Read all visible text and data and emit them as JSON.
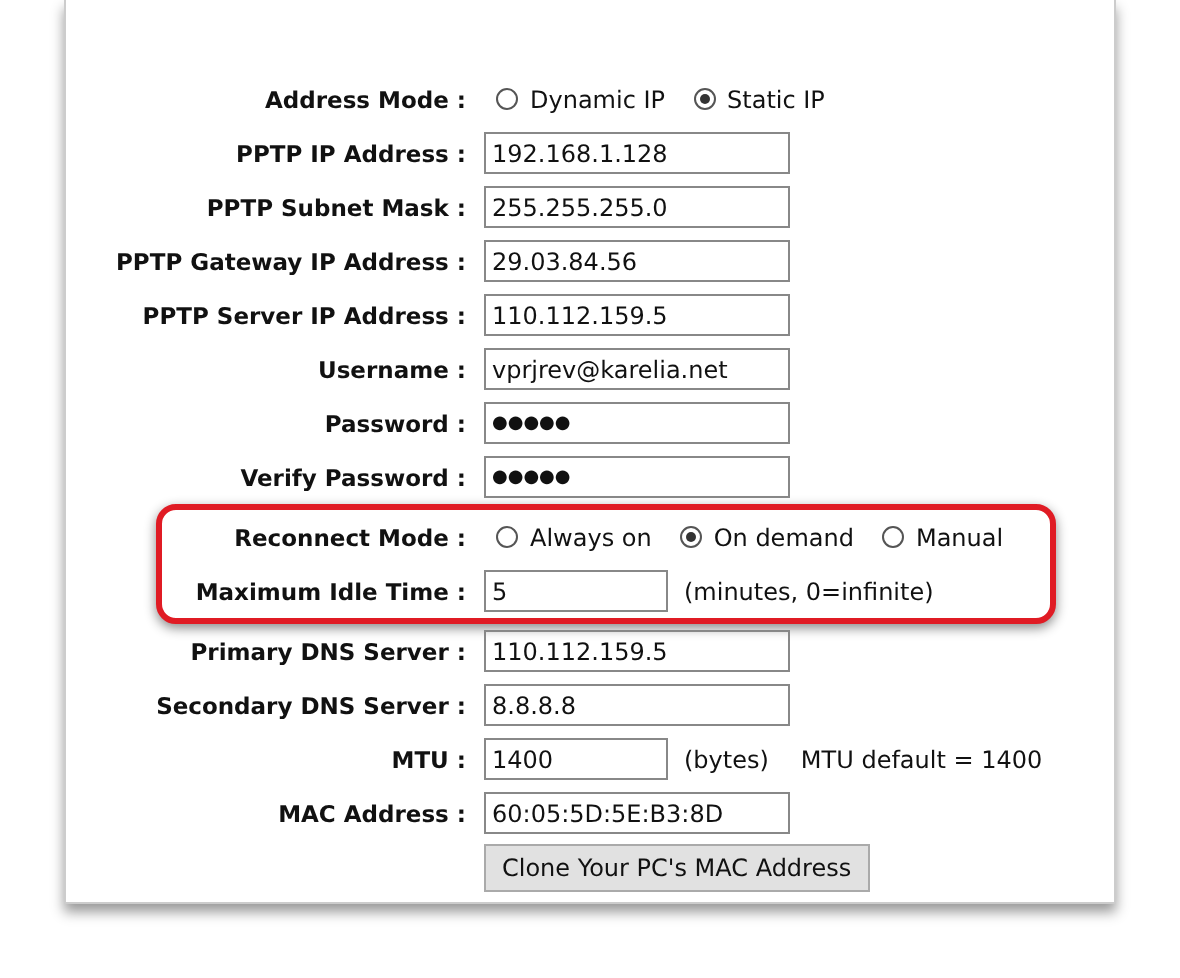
{
  "form_rows": [
    {
      "kind": "radio",
      "label": "Address Mode :",
      "options": [
        {
          "label": "Dynamic IP",
          "selected": false
        },
        {
          "label": "Static IP",
          "selected": true
        }
      ]
    },
    {
      "kind": "text",
      "label": "PPTP IP Address :",
      "value": "192.168.1.128"
    },
    {
      "kind": "text",
      "label": "PPTP Subnet Mask :",
      "value": "255.255.255.0"
    },
    {
      "kind": "text",
      "label": "PPTP Gateway IP Address :",
      "value": "29.03.84.56"
    },
    {
      "kind": "text",
      "label": "PPTP Server IP Address :",
      "value": "110.112.159.5"
    },
    {
      "kind": "text",
      "label": "Username :",
      "value": "vprjrev@karelia.net"
    },
    {
      "kind": "password",
      "label": "Password :",
      "value": "●●●●●"
    },
    {
      "kind": "password",
      "label": "Verify Password :",
      "value": "●●●●●"
    }
  ],
  "highlighted_rows": [
    {
      "kind": "radio",
      "label": "Reconnect Mode :",
      "options": [
        {
          "label": "Always on",
          "selected": false
        },
        {
          "label": "On demand",
          "selected": true
        },
        {
          "label": "Manual",
          "selected": false
        }
      ]
    },
    {
      "kind": "short",
      "label": "Maximum Idle Time :",
      "value": "5",
      "notes": [
        "(minutes, 0=infinite)"
      ]
    }
  ],
  "more_rows": [
    {
      "kind": "text",
      "label": "Primary DNS Server :",
      "value": "110.112.159.5"
    },
    {
      "kind": "text",
      "label": "Secondary DNS Server :",
      "value": "8.8.8.8"
    },
    {
      "kind": "short",
      "label": "MTU :",
      "value": "1400",
      "notes": [
        "(bytes)",
        "MTU default = 1400"
      ]
    },
    {
      "kind": "text",
      "label": "MAC Address :",
      "value": "60:05:5D:5E:B3:8D"
    },
    {
      "kind": "button",
      "label": "Clone Your PC's MAC Address"
    }
  ]
}
